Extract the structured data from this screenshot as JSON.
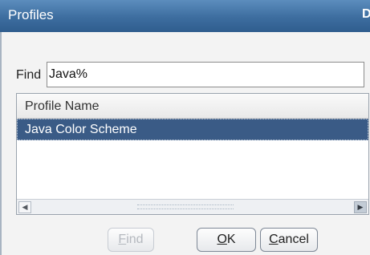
{
  "window": {
    "title": "Profiles",
    "close_glyph": "D"
  },
  "find": {
    "label": "Find",
    "value": "Java%"
  },
  "list": {
    "column_header": "Profile Name",
    "rows": [
      "Java Color Scheme"
    ],
    "selected_index": 0
  },
  "buttons": {
    "find_rest": "ind",
    "find_mnemonic": "F",
    "ok_rest": "K",
    "ok_mnemonic": "O",
    "cancel_rest": "ancel",
    "cancel_mnemonic": "C"
  },
  "colors": {
    "title_bar": "#3d6d9f",
    "selection": "#3a5b86",
    "dialog_bg": "#f3f3f3"
  },
  "icons": {
    "scroll_left": "arrow-left-icon",
    "scroll_right": "arrow-right-icon"
  }
}
